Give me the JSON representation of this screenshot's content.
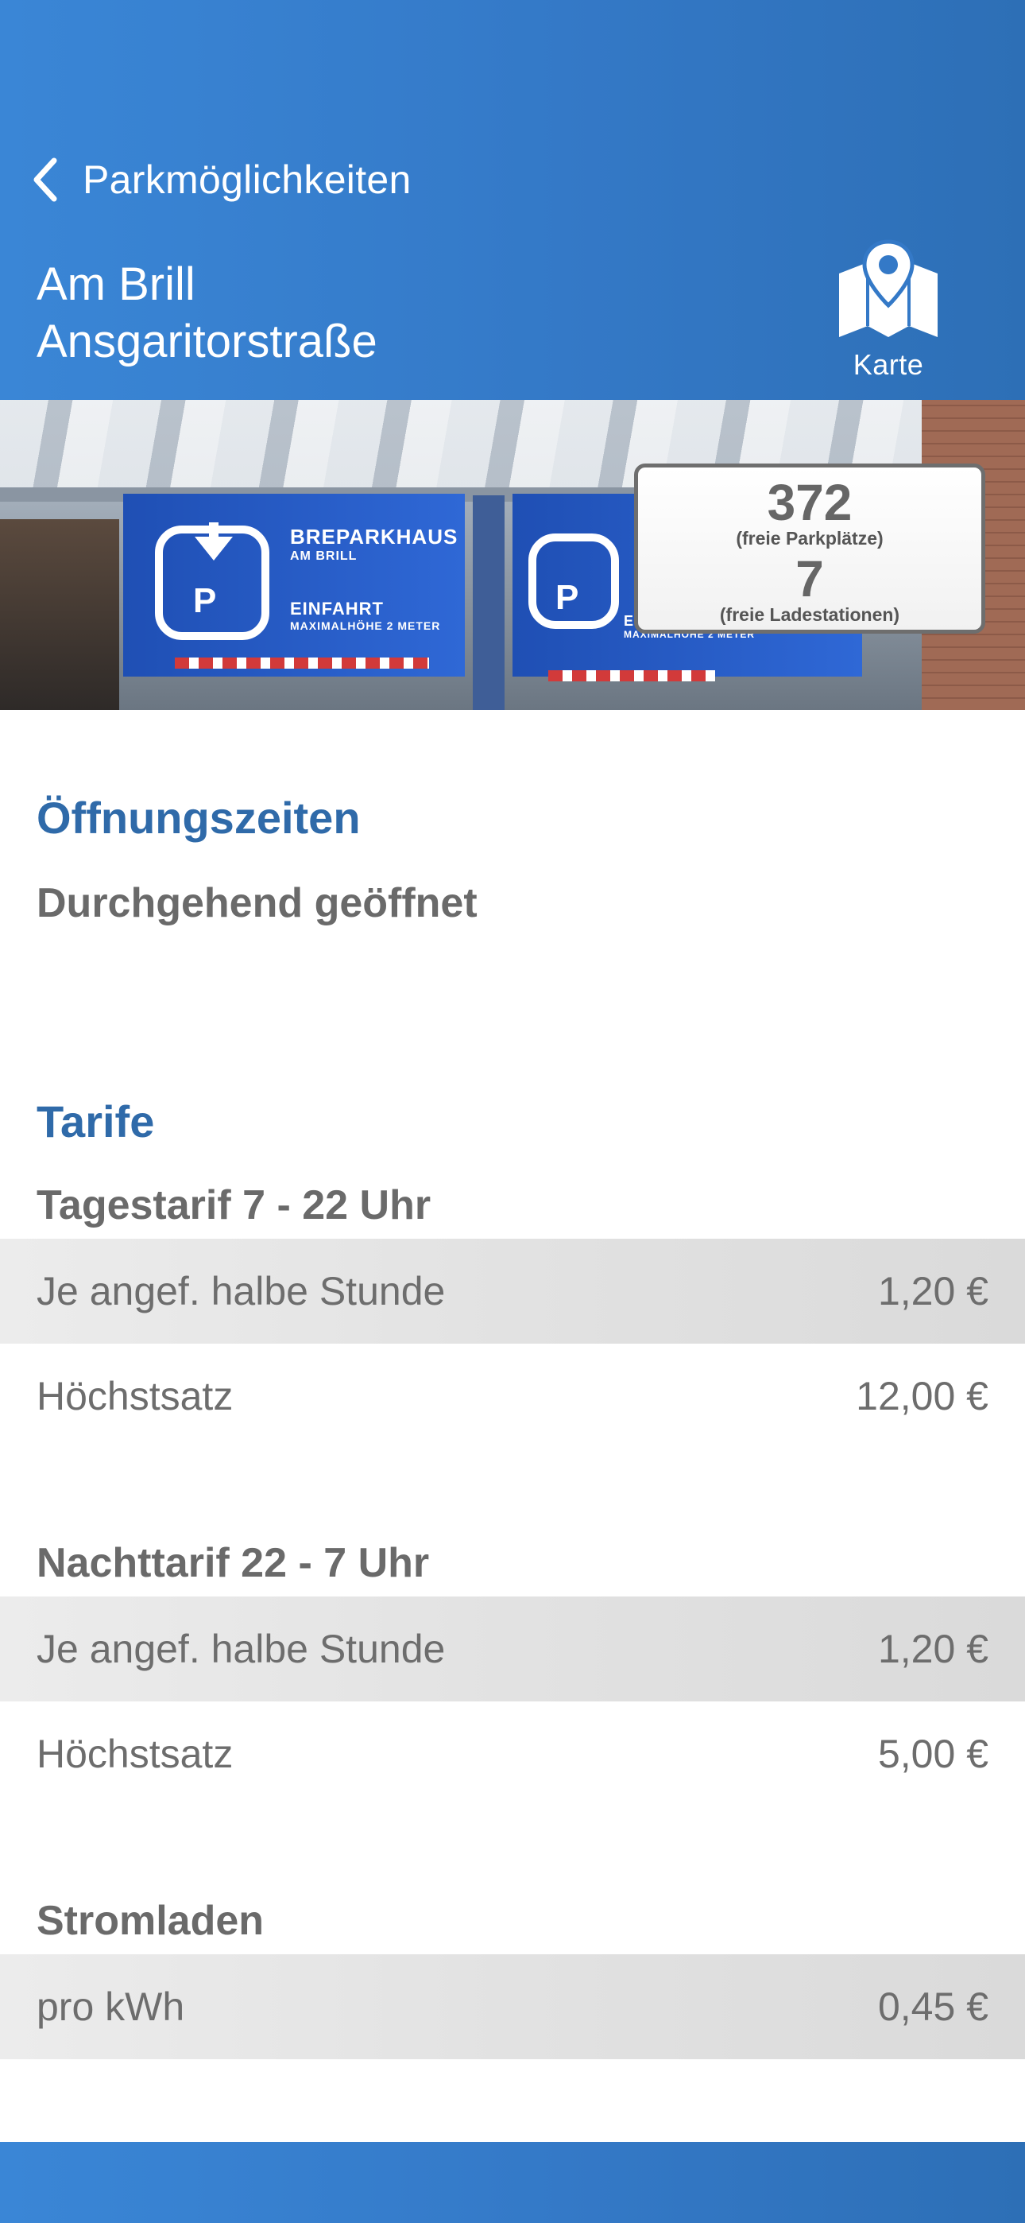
{
  "nav": {
    "back_label": "Parkmöglichkeiten",
    "title_line1": "Am Brill",
    "title_line2": "Ansgaritorstraße",
    "map_label": "Karte"
  },
  "photo": {
    "sign_brand": "BREPARKHAUS",
    "sign_location": "AM BRILL",
    "sign_entry": "EINFAHRT",
    "sign_height": "MAXIMALHÖHE 2 METER",
    "parking_letter": "P"
  },
  "availability": {
    "free_spots": "372",
    "free_spots_label": "(freie Parkplätze)",
    "free_chargers": "7",
    "free_chargers_label": "(freie Ladestationen)"
  },
  "hours": {
    "heading": "Öffnungszeiten",
    "text": "Durchgehend geöffnet"
  },
  "tariffs": {
    "heading": "Tarife",
    "groups": [
      {
        "title": "Tagestarif 7 - 22 Uhr",
        "rows": [
          {
            "label": "Je angef. halbe Stunde",
            "price": "1,20 €"
          },
          {
            "label": "Höchstsatz",
            "price": "12,00 €"
          }
        ]
      },
      {
        "title": "Nachttarif 22 - 7 Uhr",
        "rows": [
          {
            "label": "Je angef. halbe Stunde",
            "price": "1,20 €"
          },
          {
            "label": "Höchstsatz",
            "price": "5,00 €"
          }
        ]
      },
      {
        "title": "Stromladen",
        "rows": [
          {
            "label": "pro kWh",
            "price": "0,45 €"
          }
        ]
      }
    ]
  },
  "colors": {
    "header_blue": "#3479c7",
    "heading_blue": "#2f6aa9",
    "text_gray": "#6d6d6d"
  },
  "icons": {
    "back": "chevron-left-icon",
    "map": "map-pin-icon"
  }
}
